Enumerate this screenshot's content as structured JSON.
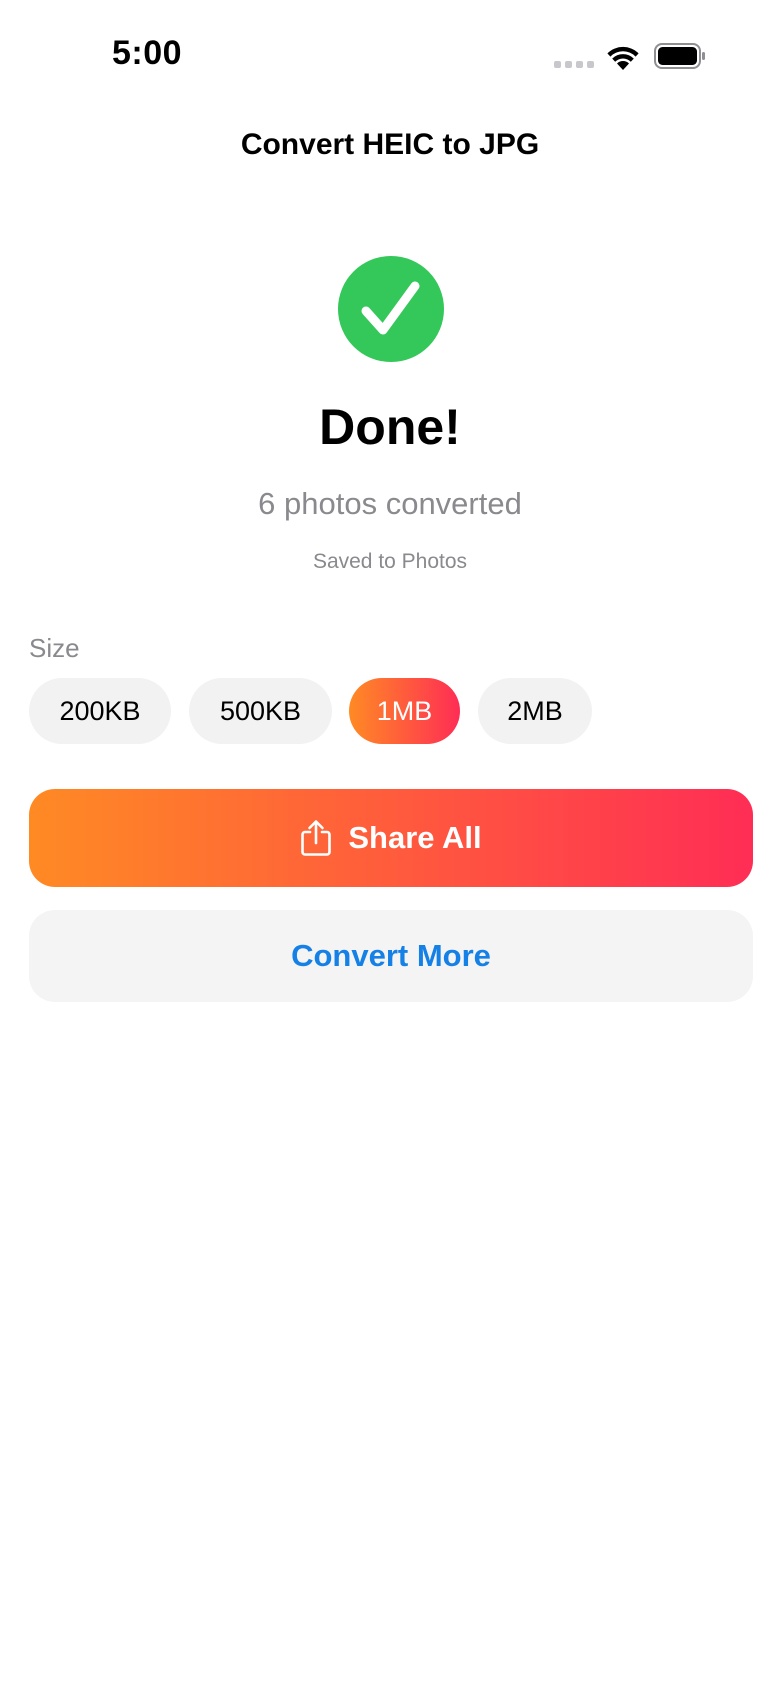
{
  "status_bar": {
    "time": "5:00",
    "signal_icon": "cellular-signal-icon",
    "wifi_icon": "wifi-icon",
    "battery_icon": "battery-icon"
  },
  "nav": {
    "title": "Convert HEIC to JPG"
  },
  "result": {
    "status_icon": "checkmark-circle-icon",
    "title": "Done!",
    "count_text": "6 photos converted",
    "saved_text": "Saved to Photos"
  },
  "size": {
    "label": "Size",
    "options": [
      "200KB",
      "500KB",
      "1MB",
      "2MB"
    ],
    "selected": "1MB"
  },
  "actions": {
    "share_label": "Share All",
    "share_icon": "share-icon",
    "convert_more_label": "Convert More"
  },
  "colors": {
    "success_green": "#34c759",
    "gradient_start": "#ff8a24",
    "gradient_end": "#ff2d55",
    "link_blue": "#1580e5",
    "secondary_text": "#8a8a8e",
    "chip_background": "#f2f2f2"
  }
}
